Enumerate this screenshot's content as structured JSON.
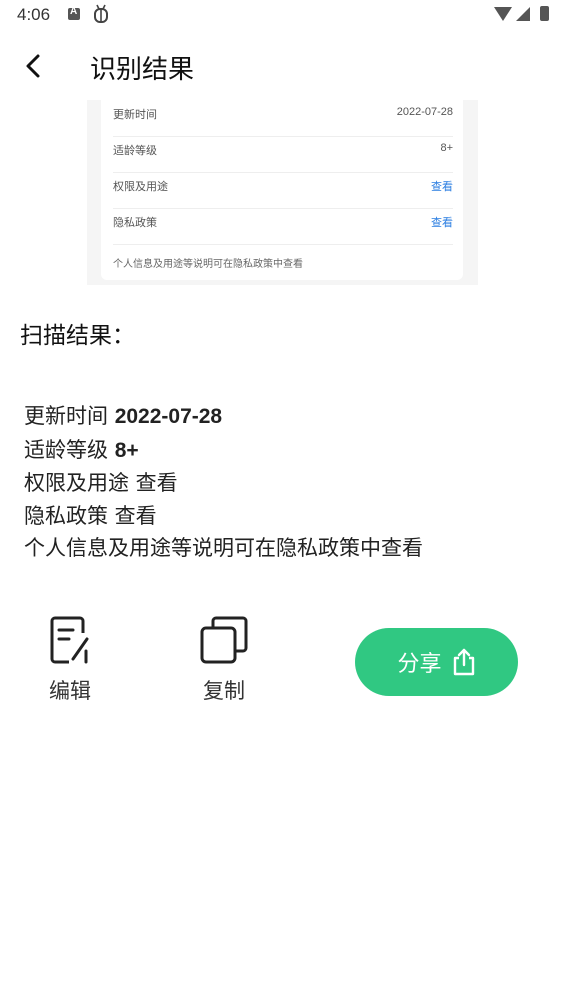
{
  "status_bar": {
    "time": "4:06",
    "icons": [
      "a-notification-icon",
      "bug-icon",
      "wifi-icon",
      "cell-signal-icon",
      "battery-icon"
    ]
  },
  "header": {
    "title": "识别结果",
    "back_icon": "chevron-left-icon"
  },
  "preview": {
    "rows": [
      {
        "label": "更新时间",
        "value": "2022-07-28"
      },
      {
        "label": "适龄等级",
        "value": "8+"
      },
      {
        "label": "权限及用途",
        "value": "查看"
      },
      {
        "label": "隐私政策",
        "value": "查看"
      }
    ],
    "note": "个人信息及用途等说明可在隐私政策中查看",
    "link_color": "#2a7de1"
  },
  "scan": {
    "title": "扫描结果：",
    "lines": [
      {
        "label": "更新时间 ",
        "value": "2022-07-28"
      },
      {
        "label": "适龄等级 ",
        "value": "8+"
      },
      {
        "label": "权限及用途 查看",
        "value": ""
      },
      {
        "label": "隐私政策 查看",
        "value": ""
      },
      {
        "label": "个人信息及用途等说明可在隐私政策中查看",
        "value": ""
      }
    ]
  },
  "actions": {
    "edit_label": "编辑",
    "copy_label": "复制",
    "share_label": "分享",
    "share_color": "#30c882"
  }
}
